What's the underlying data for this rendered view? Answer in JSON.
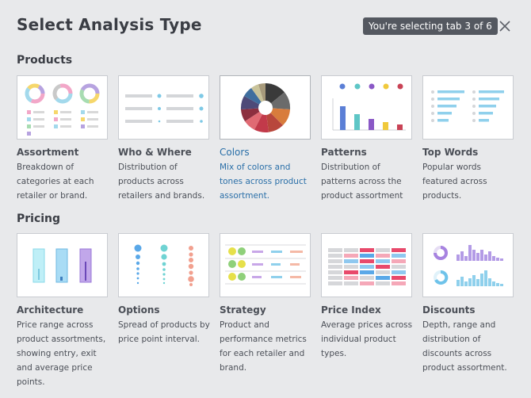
{
  "dialog": {
    "title": "Select Analysis Type",
    "tab_status": "You're selecting tab 3 of 6",
    "close_icon": "close-icon"
  },
  "colors": {
    "background": "#e8e9eb",
    "selected_text": "#2a6fa8",
    "status_bg": "#545860"
  },
  "sections": [
    {
      "title": "Products",
      "cards": [
        {
          "title": "Assortment",
          "desc": "Breakdown of categories at each retailer or brand.",
          "selected": false,
          "icon": "donut-charts-icon"
        },
        {
          "title": "Who & Where",
          "desc": "Distribution of products across retailers and brands.",
          "selected": false,
          "icon": "distribution-lines-icon"
        },
        {
          "title": "Colors",
          "desc": "Mix of colors and tones across product assortment.",
          "selected": true,
          "icon": "color-wheel-icon"
        },
        {
          "title": "Patterns",
          "desc": "Distribution of patterns across the product assortment",
          "selected": false,
          "icon": "bar-chart-icon"
        },
        {
          "title": "Top Words",
          "desc": "Popular words featured across products.",
          "selected": false,
          "icon": "word-list-icon"
        }
      ]
    },
    {
      "title": "Pricing",
      "cards": [
        {
          "title": "Architecture",
          "desc": "Price range across product assortments, showing entry, exit and average price points.",
          "selected": false,
          "icon": "price-range-bars-icon"
        },
        {
          "title": "Options",
          "desc": "Spread of products by price point interval.",
          "selected": false,
          "icon": "dot-spread-icon"
        },
        {
          "title": "Strategy",
          "desc": "Product and performance metrics for each retailer and brand.",
          "selected": false,
          "icon": "strategy-table-icon"
        },
        {
          "title": "Price Index",
          "desc": "Average prices across individual product types.",
          "selected": false,
          "icon": "price-index-table-icon"
        },
        {
          "title": "Discounts",
          "desc": "Depth, range and distribution of discounts across product assortment.",
          "selected": false,
          "icon": "discount-histogram-icon"
        }
      ]
    }
  ]
}
